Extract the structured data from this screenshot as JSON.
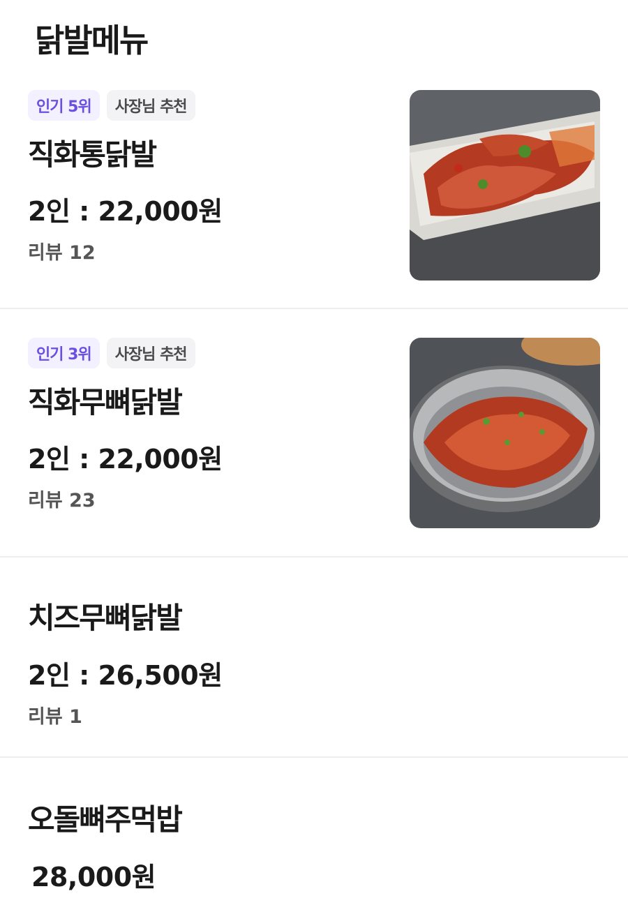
{
  "section": {
    "title": "닭발메뉴"
  },
  "items": [
    {
      "rank_badge": "인기 5위",
      "pick_badge": "사장님 추천",
      "name": "직화통닭발",
      "price": "2인 :  22,000원",
      "reviews": "리뷰 12",
      "image": "spicy-chicken-feet-on-plate"
    },
    {
      "rank_badge": "인기 3위",
      "pick_badge": "사장님 추천",
      "name": "직화무뼈닭발",
      "price": "2인 :  22,000원",
      "reviews": "리뷰 23",
      "image": "boneless-chicken-feet-in-bowl"
    },
    {
      "name": "치즈무뼈닭발",
      "price": "2인 :  26,500원",
      "reviews": "리뷰 1"
    },
    {
      "name": "오돌뼈주먹밥",
      "price": "28,000원"
    }
  ]
}
